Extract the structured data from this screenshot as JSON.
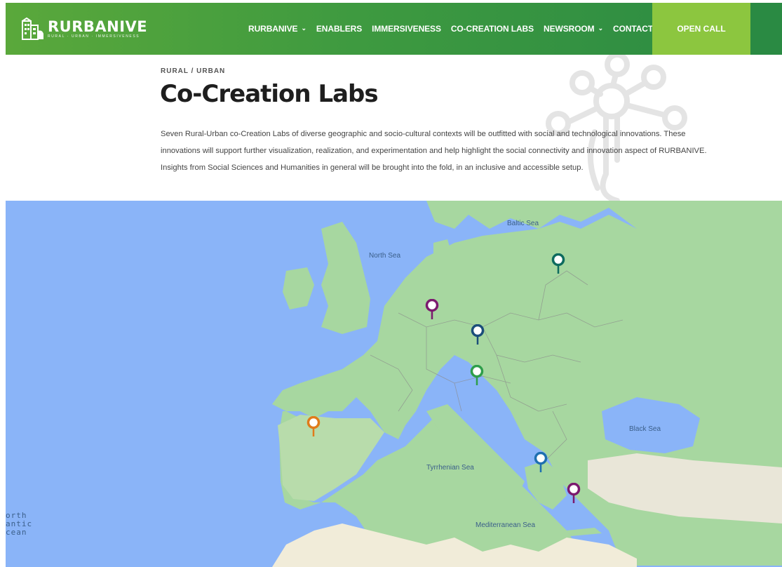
{
  "brand": {
    "name": "RURBANIVE",
    "tagline": "RURAL · URBAN · IMMERSIVENESS",
    "colors": {
      "nav_start": "#5aa83b",
      "nav_end": "#2a8a43",
      "open_call": "#8cc63f"
    }
  },
  "nav": {
    "items": [
      {
        "label": "RURBANIVE",
        "dropdown": true
      },
      {
        "label": "ENABLERS",
        "dropdown": false
      },
      {
        "label": "IMMERSIVENESS",
        "dropdown": false
      },
      {
        "label": "CO-CREATION LABS",
        "dropdown": false
      },
      {
        "label": "NEWSROOM",
        "dropdown": true
      },
      {
        "label": "CONTACT",
        "dropdown": false
      }
    ],
    "cta": "OPEN CALL"
  },
  "hero": {
    "breadcrumb": "RURAL / URBAN",
    "title": "Co-Creation Labs",
    "description_lines": [
      "Seven Rural-Urban co-Creation Labs of diverse geographic and socio-cultural contexts will be outfitted with social and technological innovations. These",
      "innovations will support further visualization, realization, and experimentation and help highlight the social connectivity and innovation aspect of RURBANIVE.",
      "Insights from Social Sciences and Humanities in general will be brought into the fold, in an inclusive and accessible setup."
    ]
  },
  "map": {
    "labels": {
      "baltic": "Baltic Sea",
      "north": "North Sea",
      "black": "Black Sea",
      "tyrrhenian": "Tyrrhenian Sea",
      "mediterranean": "Mediterranean Sea",
      "atlantic": [
        "orth",
        "antic",
        "cean"
      ]
    },
    "pins": [
      {
        "name": "pin-lithuania",
        "color": "#0e6b5e"
      },
      {
        "name": "pin-germany",
        "color": "#7b1a6e"
      },
      {
        "name": "pin-czechia",
        "color": "#1b4e7a"
      },
      {
        "name": "pin-austria",
        "color": "#2e9e4a"
      },
      {
        "name": "pin-spain",
        "color": "#e07b1a"
      },
      {
        "name": "pin-greece-north",
        "color": "#1e6fb0"
      },
      {
        "name": "pin-greece-south",
        "color": "#7b1a6e"
      }
    ]
  }
}
